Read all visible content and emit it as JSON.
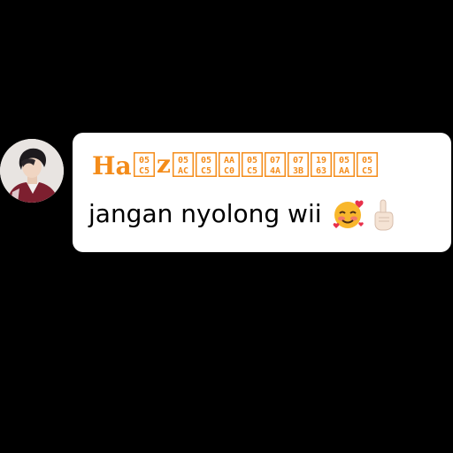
{
  "chat": {
    "sender_name": "Ha\u0005z\u0005\u0005\u0005\u0005\u0005\u0005\u0005\u0005",
    "sender_name_display": "Ha",
    "sender_name_glyphs": [
      "05\nC5",
      "z",
      "05\nAC",
      "05\nC5",
      "AA\nC0",
      "05\nC5",
      "07\n4A",
      "07\n3B",
      "19\n63",
      "05\nAA",
      "05\nC5"
    ],
    "message_text": "jangan nyolong wii",
    "emojis": [
      "smiling-face-with-hearts-icon",
      "index-pointing-up-icon"
    ]
  },
  "colors": {
    "background": "#000000",
    "bubble": "#ffffff",
    "sender_name": "#f48c1a",
    "message_text": "#000000"
  }
}
